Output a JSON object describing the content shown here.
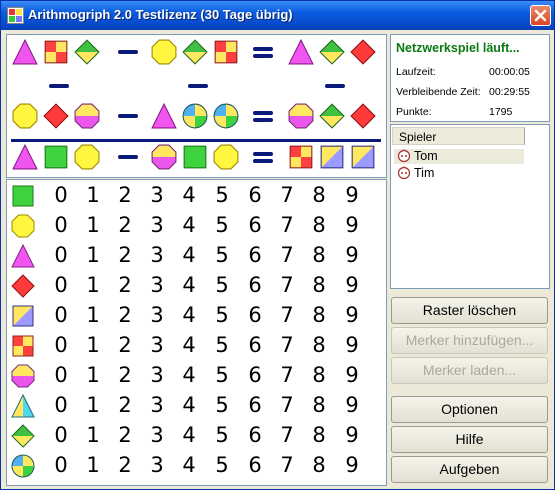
{
  "window": {
    "title": "Arithmogriph 2.0 Testlizenz (30 Tage übrig)"
  },
  "status": {
    "heading": "Netzwerkspiel läuft...",
    "rows": [
      {
        "label": "Laufzeit:",
        "value": "00:00:05"
      },
      {
        "label": "Verbleibende Zeit:",
        "value": "00:29:55"
      },
      {
        "label": "Punkte:",
        "value": "1795"
      }
    ]
  },
  "players": {
    "header": "Spieler",
    "items": [
      "Tom",
      "Tim"
    ],
    "selected_index": 0
  },
  "buttons": [
    {
      "label": "Raster löschen",
      "enabled": true
    },
    {
      "label": "Merker hinzufügen...",
      "enabled": false
    },
    {
      "label": "Merker laden...",
      "enabled": false
    },
    {
      "label": "Optionen",
      "enabled": true
    },
    {
      "label": "Hilfe",
      "enabled": true
    },
    {
      "label": "Aufgeben",
      "enabled": true
    }
  ],
  "puzzle": {
    "rows": [
      {
        "a": [
          "triangle",
          "square-checker",
          "diamond-half"
        ],
        "op1": "−",
        "b": [
          "octagon",
          "diamond-half",
          "square-checker"
        ],
        "op2": "=",
        "c": [
          "triangle",
          "diamond-half",
          "diamond"
        ]
      },
      {
        "a": [
          "octagon",
          "diamond",
          "octagon-half"
        ],
        "op1": "−",
        "b": [
          "triangle",
          "circle-quarters",
          "circle-quarters"
        ],
        "op2": "=",
        "c": [
          "octagon-half",
          "diamond-half",
          "diamond"
        ]
      },
      {
        "a": [
          "triangle",
          "square",
          "octagon"
        ],
        "op1": "−",
        "b": [
          "octagon-half",
          "square",
          "octagon"
        ],
        "op2": "=",
        "c": [
          "square-checker",
          "square-diag",
          "square-diag"
        ]
      }
    ],
    "vertical_ops": [
      "−",
      "−",
      "−"
    ]
  },
  "legend": {
    "symbols": [
      "square",
      "octagon",
      "triangle",
      "diamond",
      "square-diag",
      "square-checker",
      "octagon-half",
      "triangle-half",
      "diamond-half",
      "circle-quarters"
    ],
    "digits": [
      "0",
      "1",
      "2",
      "3",
      "4",
      "5",
      "6",
      "7",
      "8",
      "9"
    ]
  },
  "colors": {
    "accent": "#0a1a7a",
    "status_green": "#0b7a12"
  }
}
